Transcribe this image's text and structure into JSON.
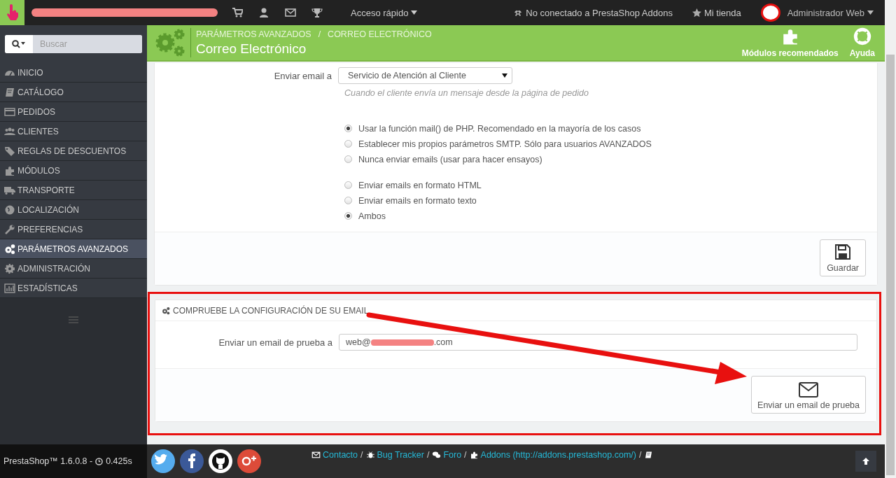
{
  "topbar": {
    "quick_access": "Acceso rápido",
    "addons_status": "No conectado a PrestaShop Addons",
    "shop_link": "Mi tienda",
    "user": "Administrador Web"
  },
  "sidebar": {
    "search_placeholder": "Buscar",
    "items": [
      {
        "label": "INICIO",
        "selected": false
      },
      {
        "label": "CATÁLOGO",
        "selected": false
      },
      {
        "label": "PEDIDOS",
        "selected": false
      },
      {
        "label": "CLIENTES",
        "selected": false
      },
      {
        "label": "REGLAS DE DESCUENTOS",
        "selected": false
      },
      {
        "label": "MÓDULOS",
        "selected": false
      },
      {
        "label": "TRANSPORTE",
        "selected": false
      },
      {
        "label": "LOCALIZACIÓN",
        "selected": false
      },
      {
        "label": "PREFERENCIAS",
        "selected": false
      },
      {
        "label": "PARÁMETROS AVANZADOS",
        "selected": true
      },
      {
        "label": "ADMINISTRACIÓN",
        "selected": false
      },
      {
        "label": "ESTADÍSTICAS",
        "selected": false
      }
    ]
  },
  "header": {
    "breadcrumb": [
      "PARÁMETROS AVANZADOS",
      "CORREO ELECTRÓNICO"
    ],
    "breadcrumb_separator": "/",
    "title": "Correo Electrónico",
    "toolbar": [
      "Módulos recomendados",
      "Ayuda"
    ]
  },
  "email_form": {
    "send_to": {
      "label": "Enviar email a",
      "value": "Servicio de Atención al Cliente",
      "help": "Cuando el cliente envía un mensaje desde la página de pedido"
    },
    "method_options": [
      {
        "label": "Usar la función mail() de PHP. Recomendado en la mayoría de los casos",
        "selected": true
      },
      {
        "label": "Establecer mis propios parámetros SMTP. Sólo para usuarios AVANZADOS",
        "selected": false
      },
      {
        "label": "Nunca enviar emails (usar para hacer ensayos)",
        "selected": false
      }
    ],
    "format_options": [
      {
        "label": "Enviar emails en formato HTML",
        "selected": false
      },
      {
        "label": "Enviar emails en formato texto",
        "selected": false
      },
      {
        "label": "Ambos",
        "selected": true
      }
    ],
    "save_button": "Guardar"
  },
  "test_panel": {
    "title": "COMPRUEBE LA CONFIGURACIÓN DE SU EMAIL",
    "field_label": "Enviar un email de prueba a",
    "value_start": "web@",
    "value_end": ".com",
    "button": "Enviar un email de prueba"
  },
  "footer": {
    "version": "PrestaShop™ 1.6.0.8 -",
    "time": "0.425s",
    "separator": "/",
    "links": [
      "Contacto",
      "Bug Tracker",
      "Foro",
      "Addons (http://addons.prestashop.com/)"
    ]
  }
}
